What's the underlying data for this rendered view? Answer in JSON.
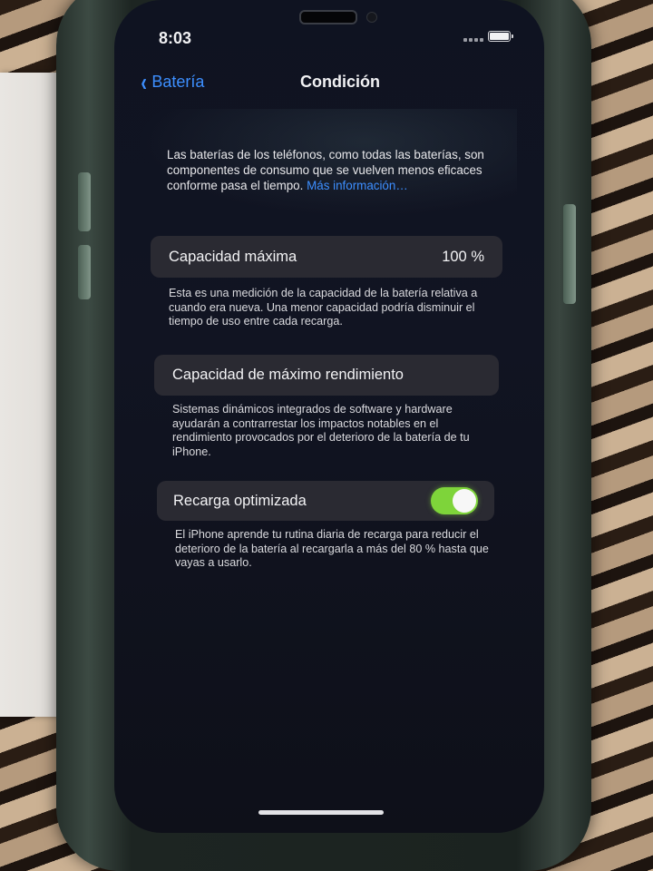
{
  "status_bar": {
    "time": "8:03",
    "battery_icon": "battery-full-icon",
    "signal_icon": "signal-bars-icon"
  },
  "nav": {
    "back_label": "Batería",
    "back_icon": "chevron-left-icon",
    "title": "Condición"
  },
  "intro": {
    "text": "Las baterías de los teléfonos, como todas las baterías, son componentes de consumo que se vuelven menos eficaces conforme pasa el tiempo.",
    "link": "Más información…"
  },
  "max_capacity": {
    "label": "Capacidad máxima",
    "value": "100 %",
    "footer": "Esta es una medición de la capacidad de la batería relativa a cuando era nueva. Una menor capacidad podría disminuir el tiempo de uso entre cada recarga."
  },
  "peak_performance": {
    "label": "Capacidad de máximo rendimiento",
    "footer": "Sistemas dinámicos integrados de software y hardware ayudarán a contrarrestar los impactos notables en el rendimiento provocados por el deterioro de la batería de tu iPhone."
  },
  "optimized_charging": {
    "label": "Recarga optimizada",
    "enabled": true,
    "footer": "El iPhone aprende tu rutina diaria de recarga para reducir el deterioro de la batería al recargarla a más del 80 % hasta que vayas a usarlo."
  },
  "colors": {
    "accent_blue": "#3d8fff",
    "toggle_on": "#7ed43a",
    "cell_background": "#2a2a32",
    "screen_background": "#111422"
  }
}
